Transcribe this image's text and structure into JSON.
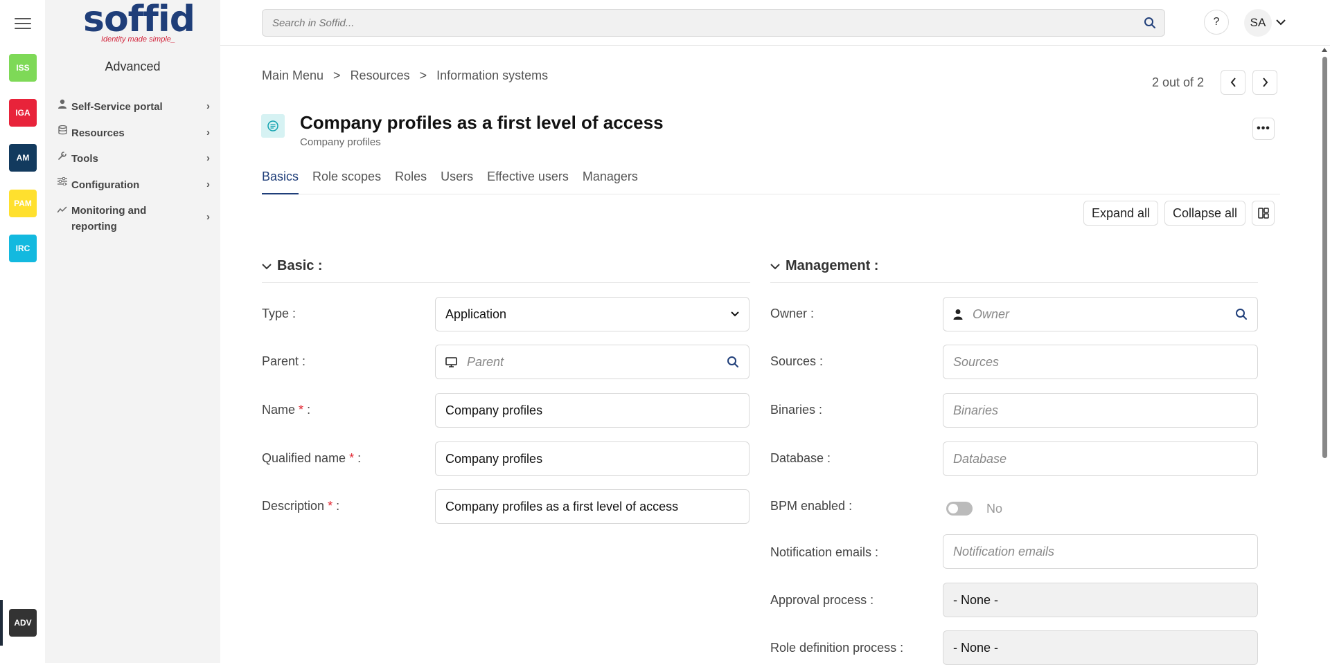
{
  "app": {
    "logo_text": "soffid",
    "logo_tagline": "Identity made simple_"
  },
  "rail": {
    "apps": [
      {
        "label": "ISS",
        "color": "#7ed957"
      },
      {
        "label": "IGA",
        "color": "#e8233a"
      },
      {
        "label": "AM",
        "color": "#123a5e"
      },
      {
        "label": "PAM",
        "color": "#ffe02e"
      },
      {
        "label": "IRC",
        "color": "#13b9df"
      },
      {
        "label": "ADV",
        "color": "#333333"
      }
    ]
  },
  "sidebar": {
    "title": "Advanced",
    "items": [
      {
        "label": "Self-Service portal",
        "icon": "person-icon"
      },
      {
        "label": "Resources",
        "icon": "database-icon"
      },
      {
        "label": "Tools",
        "icon": "wrench-icon"
      },
      {
        "label": "Configuration",
        "icon": "sliders-icon"
      },
      {
        "label": "Monitoring and reporting",
        "icon": "chart-icon"
      }
    ]
  },
  "topbar": {
    "search_placeholder": "Search in Soffid...",
    "help_label": "?",
    "user_initials": "SA"
  },
  "breadcrumb": {
    "items": [
      "Main Menu",
      "Resources",
      "Information systems"
    ],
    "separator": ">"
  },
  "pager": {
    "text": "2 out of 2"
  },
  "header": {
    "title": "Company profiles as a first level of access",
    "subtitle": "Company profiles",
    "more_label": "•••"
  },
  "tabs": [
    {
      "label": "Basics",
      "active": true
    },
    {
      "label": "Role scopes"
    },
    {
      "label": "Roles"
    },
    {
      "label": "Users"
    },
    {
      "label": "Effective users"
    },
    {
      "label": "Managers"
    }
  ],
  "toolbar": {
    "expand_label": "Expand all",
    "collapse_label": "Collapse all"
  },
  "basic": {
    "title": "Basic :",
    "type_label": "Type :",
    "type_value": "Application",
    "parent_label": "Parent :",
    "parent_placeholder": "Parent",
    "name_label": "Name",
    "name_value": "Company profiles",
    "qualified_label": "Qualified name",
    "qualified_value": "Company profiles",
    "description_label": "Description",
    "description_value": "Company profiles as a first level of access",
    "required_mark": "*",
    "colon": ":"
  },
  "management": {
    "title": "Management :",
    "owner_label": "Owner :",
    "owner_placeholder": "Owner",
    "sources_label": "Sources :",
    "sources_placeholder": "Sources",
    "binaries_label": "Binaries :",
    "binaries_placeholder": "Binaries",
    "database_label": "Database :",
    "database_placeholder": "Database",
    "bpm_label": "BPM enabled :",
    "bpm_value": "No",
    "notification_label": "Notification emails :",
    "notification_placeholder": "Notification emails",
    "approval_label": "Approval process :",
    "approval_value": "- None -",
    "roledef_label": "Role definition process :",
    "roledef_value": "- None -"
  }
}
